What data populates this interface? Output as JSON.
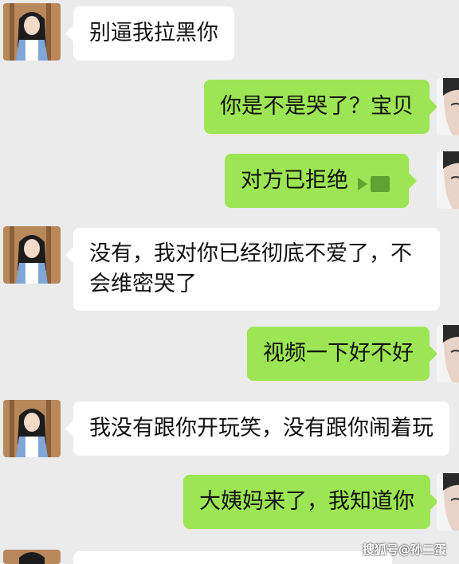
{
  "messages": [
    {
      "side": "left",
      "text": "别逼我拉黑你"
    },
    {
      "side": "right",
      "text": "你是不是哭了？宝贝"
    },
    {
      "side": "right",
      "text": "对方已拒绝",
      "icon": "video-call-icon"
    },
    {
      "side": "left",
      "text": "没有，我对你已经彻底不爱了，不会维密哭了"
    },
    {
      "side": "right",
      "text": "视频一下好不好"
    },
    {
      "side": "left",
      "text": "我没有跟你开玩笑，没有跟你闹着玩"
    },
    {
      "side": "right",
      "text": "大姨妈来了，我知道你"
    }
  ],
  "watermark": "搜狐号@孙二蛋",
  "colors": {
    "background": "#ebebeb",
    "sent_bubble": "#9ce554",
    "received_bubble": "#ffffff"
  }
}
